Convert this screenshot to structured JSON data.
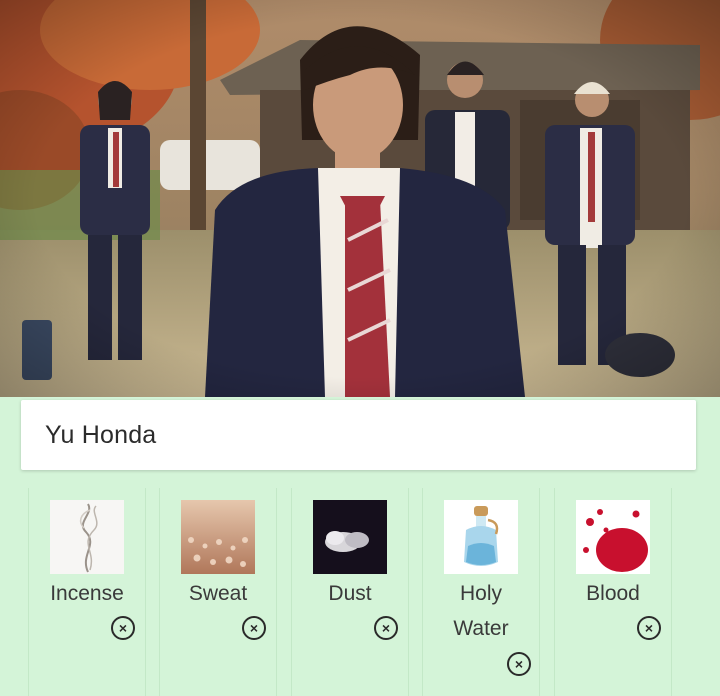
{
  "profile": {
    "name": "Yu Honda"
  },
  "elements": [
    {
      "label": "Incense",
      "icon": "incense-smoke-image"
    },
    {
      "label": "Sweat",
      "icon": "sweat-droplets-image"
    },
    {
      "label": "Dust",
      "icon": "dust-cloud-image"
    },
    {
      "label": "Holy Water",
      "label_line1": "Holy",
      "label_line2": "Water",
      "icon": "holy-water-bottle-image"
    },
    {
      "label": "Blood",
      "icon": "blood-splatter-image"
    }
  ],
  "remove_symbol": "×",
  "colors": {
    "background": "#d4f4d8",
    "card": "#ffffff",
    "text": "#3a3a3a"
  }
}
